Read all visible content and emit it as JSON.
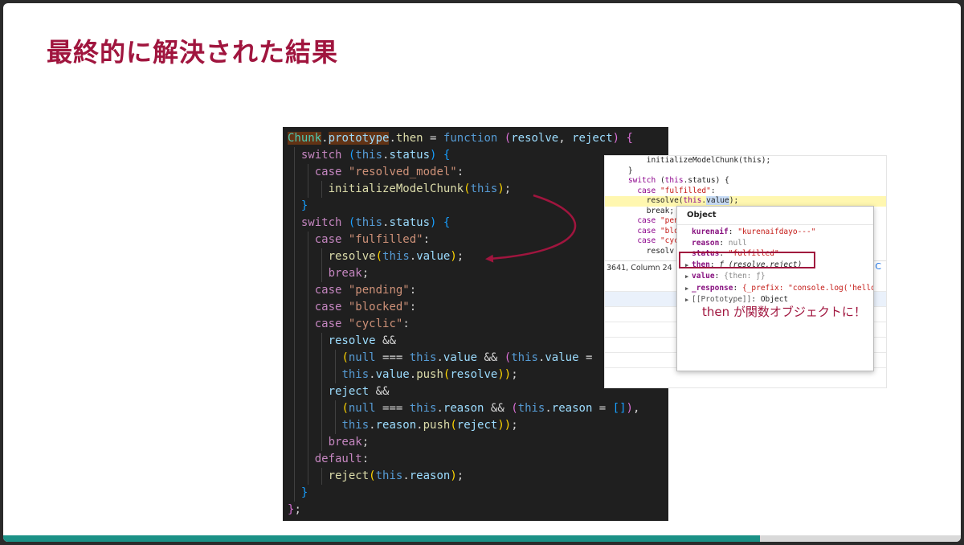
{
  "slide": {
    "title": "最終的に解決された結果",
    "progress": 0.79
  },
  "editor": {
    "lines": [
      {
        "indent": 0,
        "tokens": [
          [
            "cls hl-word",
            "Chunk"
          ],
          [
            "pun",
            "."
          ],
          [
            "var hl-word",
            "prototype"
          ],
          [
            "pun",
            "."
          ],
          [
            "fn",
            "then"
          ],
          [
            "pun",
            " = "
          ],
          [
            "kw",
            "function"
          ],
          [
            "pun",
            " "
          ],
          [
            "br2",
            "("
          ],
          [
            "var",
            "resolve"
          ],
          [
            "pun",
            ", "
          ],
          [
            "var",
            "reject"
          ],
          [
            "br2",
            ")"
          ],
          [
            "pun",
            " "
          ],
          [
            "br2",
            "{"
          ]
        ]
      },
      {
        "indent": 1,
        "tokens": [
          [
            "ct",
            "switch"
          ],
          [
            "pun",
            " "
          ],
          [
            "br3",
            "("
          ],
          [
            "kw",
            "this"
          ],
          [
            "pun",
            "."
          ],
          [
            "var",
            "status"
          ],
          [
            "br3",
            ")"
          ],
          [
            "pun",
            " "
          ],
          [
            "br3",
            "{"
          ]
        ]
      },
      {
        "indent": 2,
        "tokens": [
          [
            "ct",
            "case"
          ],
          [
            "pun",
            " "
          ],
          [
            "str",
            "\"resolved_model\""
          ],
          [
            "pun",
            ":"
          ]
        ]
      },
      {
        "indent": 3,
        "tokens": [
          [
            "fn",
            "initializeModelChunk"
          ],
          [
            "br1",
            "("
          ],
          [
            "kw",
            "this"
          ],
          [
            "br1",
            ")"
          ],
          [
            "pun",
            ";"
          ]
        ]
      },
      {
        "indent": 1,
        "tokens": [
          [
            "br3",
            "}"
          ]
        ]
      },
      {
        "indent": 1,
        "tokens": [
          [
            "ct",
            "switch"
          ],
          [
            "pun",
            " "
          ],
          [
            "br3",
            "("
          ],
          [
            "kw",
            "this"
          ],
          [
            "pun",
            "."
          ],
          [
            "var",
            "status"
          ],
          [
            "br3",
            ")"
          ],
          [
            "pun",
            " "
          ],
          [
            "br3",
            "{"
          ]
        ]
      },
      {
        "indent": 2,
        "tokens": [
          [
            "ct",
            "case"
          ],
          [
            "pun",
            " "
          ],
          [
            "str",
            "\"fulfilled\""
          ],
          [
            "pun",
            ":"
          ]
        ]
      },
      {
        "indent": 3,
        "tokens": [
          [
            "fn",
            "resolve"
          ],
          [
            "br1",
            "("
          ],
          [
            "kw",
            "this"
          ],
          [
            "pun",
            "."
          ],
          [
            "var",
            "value"
          ],
          [
            "br1",
            ")"
          ],
          [
            "pun",
            ";"
          ]
        ]
      },
      {
        "indent": 3,
        "tokens": [
          [
            "ct",
            "break"
          ],
          [
            "pun",
            ";"
          ]
        ]
      },
      {
        "indent": 2,
        "tokens": [
          [
            "ct",
            "case"
          ],
          [
            "pun",
            " "
          ],
          [
            "str",
            "\"pending\""
          ],
          [
            "pun",
            ":"
          ]
        ]
      },
      {
        "indent": 2,
        "tokens": [
          [
            "ct",
            "case"
          ],
          [
            "pun",
            " "
          ],
          [
            "str",
            "\"blocked\""
          ],
          [
            "pun",
            ":"
          ]
        ]
      },
      {
        "indent": 2,
        "tokens": [
          [
            "ct",
            "case"
          ],
          [
            "pun",
            " "
          ],
          [
            "str",
            "\"cyclic\""
          ],
          [
            "pun",
            ":"
          ]
        ]
      },
      {
        "indent": 3,
        "tokens": [
          [
            "var",
            "resolve"
          ],
          [
            "pun",
            " &&"
          ]
        ]
      },
      {
        "indent": 4,
        "tokens": [
          [
            "br1",
            "("
          ],
          [
            "kw",
            "null"
          ],
          [
            "pun",
            " === "
          ],
          [
            "kw",
            "this"
          ],
          [
            "pun",
            "."
          ],
          [
            "var",
            "value"
          ],
          [
            "pun",
            " && "
          ],
          [
            "br2",
            "("
          ],
          [
            "kw",
            "this"
          ],
          [
            "pun",
            "."
          ],
          [
            "var",
            "value"
          ],
          [
            "pun",
            " ="
          ]
        ]
      },
      {
        "indent": 4,
        "tokens": [
          [
            "kw",
            "this"
          ],
          [
            "pun",
            "."
          ],
          [
            "var",
            "value"
          ],
          [
            "pun",
            "."
          ],
          [
            "fn",
            "push"
          ],
          [
            "br1",
            "("
          ],
          [
            "var",
            "resolve"
          ],
          [
            "br1",
            ")"
          ],
          [
            "br1",
            ")"
          ],
          [
            "pun",
            ";"
          ]
        ]
      },
      {
        "indent": 3,
        "tokens": [
          [
            "var",
            "reject"
          ],
          [
            "pun",
            " &&"
          ]
        ]
      },
      {
        "indent": 4,
        "tokens": [
          [
            "br1",
            "("
          ],
          [
            "kw",
            "null"
          ],
          [
            "pun",
            " === "
          ],
          [
            "kw",
            "this"
          ],
          [
            "pun",
            "."
          ],
          [
            "var",
            "reason"
          ],
          [
            "pun",
            " && "
          ],
          [
            "br2",
            "("
          ],
          [
            "kw",
            "this"
          ],
          [
            "pun",
            "."
          ],
          [
            "var",
            "reason"
          ],
          [
            "pun",
            " = "
          ],
          [
            "br3",
            "[]"
          ],
          [
            "br2",
            ")"
          ],
          [
            "pun",
            ","
          ]
        ]
      },
      {
        "indent": 4,
        "tokens": [
          [
            "kw",
            "this"
          ],
          [
            "pun",
            "."
          ],
          [
            "var",
            "reason"
          ],
          [
            "pun",
            "."
          ],
          [
            "fn",
            "push"
          ],
          [
            "br1",
            "("
          ],
          [
            "var",
            "reject"
          ],
          [
            "br1",
            ")"
          ],
          [
            "br1",
            ")"
          ],
          [
            "pun",
            ";"
          ]
        ]
      },
      {
        "indent": 3,
        "tokens": [
          [
            "ct",
            "break"
          ],
          [
            "pun",
            ";"
          ]
        ]
      },
      {
        "indent": 2,
        "tokens": [
          [
            "ct",
            "default"
          ],
          [
            "pun",
            ":"
          ]
        ]
      },
      {
        "indent": 3,
        "tokens": [
          [
            "fn",
            "reject"
          ],
          [
            "br1",
            "("
          ],
          [
            "kw",
            "this"
          ],
          [
            "pun",
            "."
          ],
          [
            "var",
            "reason"
          ],
          [
            "br1",
            ")"
          ],
          [
            "pun",
            ";"
          ]
        ]
      },
      {
        "indent": 1,
        "tokens": [
          [
            "br3",
            "}"
          ]
        ]
      },
      {
        "indent": 0,
        "tokens": [
          [
            "br2",
            "}"
          ],
          [
            "pun",
            ";"
          ]
        ]
      }
    ]
  },
  "devtools": {
    "lines": [
      {
        "hl": false,
        "tokens": [
          [
            "",
            "        initializeModelChunk(this);"
          ]
        ]
      },
      {
        "hl": false,
        "tokens": [
          [
            "",
            "    }"
          ]
        ]
      },
      {
        "hl": false,
        "tokens": [
          [
            "",
            "    "
          ],
          [
            "dt-kw",
            "switch"
          ],
          [
            "",
            " ("
          ],
          [
            "dt-kw",
            "this"
          ],
          [
            "",
            ".status) {"
          ]
        ]
      },
      {
        "hl": false,
        "tokens": [
          [
            "",
            "      "
          ],
          [
            "dt-kw",
            "case"
          ],
          [
            "",
            " "
          ],
          [
            "dt-str",
            "\"fulfilled\""
          ],
          [
            "",
            ":"
          ]
        ]
      },
      {
        "hl": true,
        "tokens": [
          [
            "",
            "        resolve("
          ],
          [
            "dt-kw",
            "this"
          ],
          [
            "",
            "."
          ],
          [
            "dt-sel",
            "value"
          ],
          [
            "",
            ");"
          ]
        ]
      },
      {
        "hl": false,
        "tokens": [
          [
            "",
            "        break;"
          ]
        ]
      },
      {
        "hl": false,
        "tokens": [
          [
            "",
            "      "
          ],
          [
            "dt-kw",
            "case"
          ],
          [
            "",
            " "
          ],
          [
            "dt-str",
            "\"pen"
          ]
        ]
      },
      {
        "hl": false,
        "tokens": [
          [
            "",
            "      "
          ],
          [
            "dt-kw",
            "case"
          ],
          [
            "",
            " "
          ],
          [
            "dt-str",
            "\"blo"
          ]
        ]
      },
      {
        "hl": false,
        "tokens": [
          [
            "",
            "      "
          ],
          [
            "dt-kw",
            "case"
          ],
          [
            "",
            " "
          ],
          [
            "dt-str",
            "\"cyc"
          ]
        ]
      },
      {
        "hl": false,
        "tokens": [
          [
            "",
            "        resolv"
          ]
        ]
      }
    ],
    "status_text": "3641, Column 24",
    "right_letter": "C"
  },
  "popup": {
    "header": "Object",
    "props": [
      {
        "tri": false,
        "key": "kurenaif",
        "bold": true,
        "sep": ": ",
        "val": "\"kurenaifdayo---\"",
        "vclass": "pv-str"
      },
      {
        "tri": false,
        "key": "reason",
        "bold": true,
        "sep": ": ",
        "val": "null",
        "vclass": "pv-num"
      },
      {
        "tri": false,
        "key": "status",
        "bold": true,
        "sep": ": ",
        "val": "\"fulfilled\"",
        "vclass": "pv-str"
      },
      {
        "tri": true,
        "key": "then",
        "bold": true,
        "sep": ": ",
        "val": "ƒ (resolve,reject)",
        "vclass": "pv-fn"
      },
      {
        "tri": true,
        "key": "value",
        "bold": true,
        "sep": ": ",
        "val": "{then: ƒ}",
        "vclass": "pv-num"
      },
      {
        "tri": true,
        "key": "_response",
        "bold": true,
        "sep": ": ",
        "val": "{_prefix: \"console.log('hello')",
        "vclass": "pv-str"
      },
      {
        "tri": true,
        "key": "[[Prototype]]",
        "bold": false,
        "sep": ": ",
        "val": "Object",
        "vclass": ""
      }
    ]
  },
  "annotation": "then が関数オブジェクトに！",
  "colors": {
    "accent": "#a0153e",
    "progress": "#1b9186",
    "editor_bg": "#1f1f1f"
  }
}
